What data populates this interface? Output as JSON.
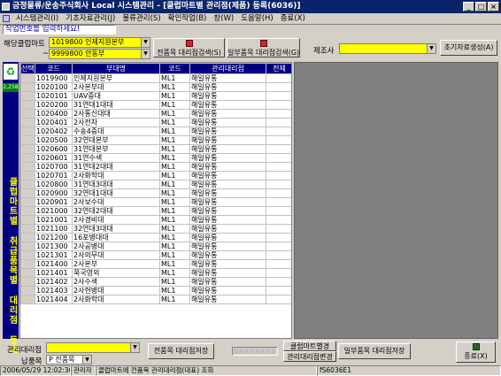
{
  "window": {
    "title": "금정물류/운송주식회사 Local  시스템관리 - [클럽마트별 관리점(제품) 등록(6036)]",
    "controls": [
      "_",
      "□",
      "×"
    ]
  },
  "menu": [
    "시스템관리(I)",
    "기초자료관리(J)",
    "물류관리(S)",
    "확인작업(B)",
    "창(W)",
    "도움말(H)",
    "종료(X)"
  ],
  "notice": "작업번호를 입력하세요!",
  "filters": {
    "mart_label": "해당클럽마트",
    "mart_from": "1019800 인제지원본부",
    "mart_to": "9999800 안동부",
    "mart_to_prefix": "~",
    "maker_label": "제조사"
  },
  "toolbar": {
    "btn_all_save": "전품목 대리점검색(S)",
    "btn_partial_save": "일부품목 대리점검색(G)",
    "btn_init": "초기자료생성(A)"
  },
  "grid": {
    "columns": [
      "선택",
      "코드",
      "부대명",
      "코드",
      "관리대리점",
      "전체"
    ],
    "rows": [
      [
        "1019900",
        "인제지원본부",
        "ML1",
        "해일유통"
      ],
      [
        "1020100",
        "2사본부대",
        "ML1",
        "해일유통"
      ],
      [
        "1020101",
        "UAV중대",
        "ML1",
        "해일유통"
      ],
      [
        "1020200",
        "31연대1대대",
        "ML1",
        "해일유통"
      ],
      [
        "1020400",
        "2사통신대대",
        "ML1",
        "해일유통"
      ],
      [
        "1020401",
        "2사전차",
        "ML1",
        "해일유통"
      ],
      [
        "1020402",
        "수송4중대",
        "ML1",
        "해일유통"
      ],
      [
        "1020500",
        "32연대본부",
        "ML1",
        "해일유통"
      ],
      [
        "1020600",
        "31연대본부",
        "ML1",
        "해일유통"
      ],
      [
        "1020601",
        "31연수색",
        "ML1",
        "해일유통"
      ],
      [
        "1020700",
        "31연대2대대",
        "ML1",
        "해일유통"
      ],
      [
        "1020701",
        "2사화학대",
        "ML1",
        "해일유통"
      ],
      [
        "1020800",
        "31연대3대대",
        "ML1",
        "해일유통"
      ],
      [
        "1020900",
        "32연대1대대",
        "ML1",
        "해일유통"
      ],
      [
        "1020901",
        "2사보수대",
        "ML1",
        "해일유통"
      ],
      [
        "1021000",
        "32연대2대대",
        "ML1",
        "해일유통"
      ],
      [
        "1021001",
        "2사경비대",
        "ML1",
        "해일유통"
      ],
      [
        "1021100",
        "32연대3대대",
        "ML1",
        "해일유통"
      ],
      [
        "1021200",
        "16포병대대",
        "ML1",
        "해일유통"
      ],
      [
        "1021300",
        "2사공병대",
        "ML1",
        "해일유통"
      ],
      [
        "1021301",
        "2사의무대",
        "ML1",
        "해일유통"
      ],
      [
        "1021400",
        "2사본부",
        "ML1",
        "해일유통"
      ],
      [
        "1021401",
        "쭉국영외",
        "ML1",
        "해일유통"
      ],
      [
        "1021402",
        "2사수색",
        "ML1",
        "해일유통"
      ],
      [
        "1021403",
        "2사헌병대",
        "ML1",
        "해일유통"
      ],
      [
        "1021404",
        "2사화학대",
        "ML1",
        "해일유통"
      ]
    ]
  },
  "side": {
    "count": "2,258",
    "vertical_title": "클럽마트별 취급품목별 대리점 등록"
  },
  "bottom": {
    "agent_label": "관리대리점",
    "deliver_label": "납품목",
    "deliver_value": "P 전품목",
    "btn_all_save": "전품목 대리점저장",
    "btn_club_change": "클럽마트별경",
    "btn_agent_change": "관리대리점변경",
    "btn_partial_save": "일부품목 대리점저장",
    "btn_exit": "종료(X)"
  },
  "status": {
    "datetime": "2006/05/29 12:02:30 오전",
    "user": "관리자",
    "message": "클럽마트에 전품목 관리대리점(대표) 조회",
    "code": "fS6036E1"
  }
}
